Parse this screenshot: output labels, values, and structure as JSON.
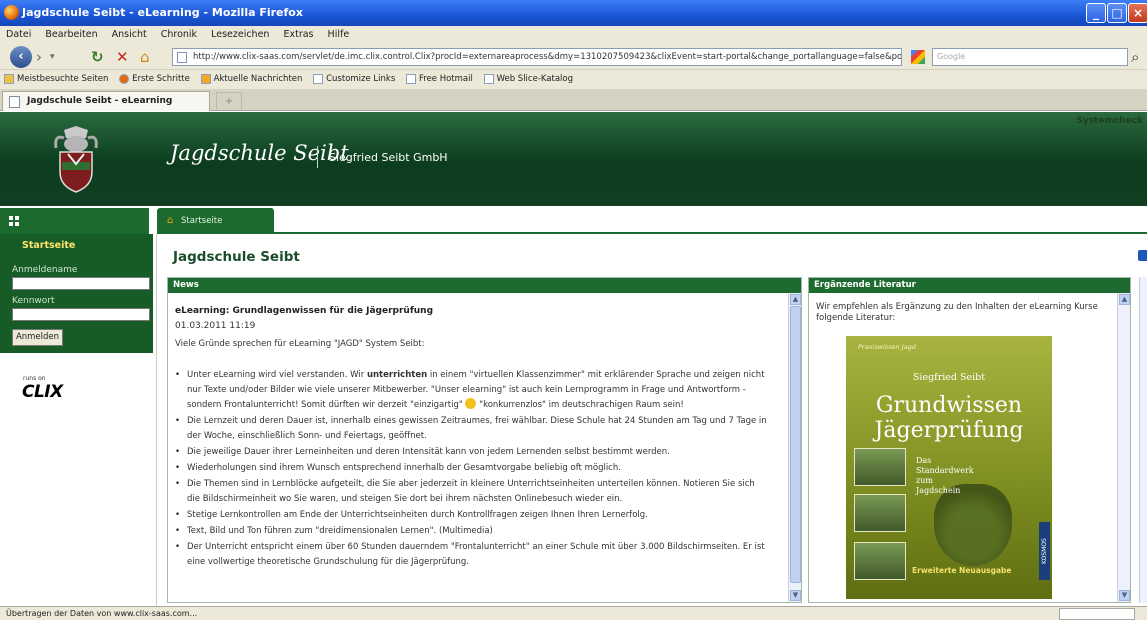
{
  "window": {
    "title": "Jagdschule Seibt - eLearning - Mozilla Firefox",
    "controls": {
      "minimize": "_",
      "maximize": "□",
      "close": "×"
    }
  },
  "menu": [
    "Datei",
    "Bearbeiten",
    "Ansicht",
    "Chronik",
    "Lesezeichen",
    "Extras",
    "Hilfe"
  ],
  "nav": {
    "url": "http://www.clix-saas.com/servlet/de.imc.clix.control.Clix?procId=externareaprocess&dmy=1310207509423&clixEvent=start-portal&change_portallanguage=false&porta",
    "search_placeholder": "Google"
  },
  "bookmarks": [
    "Meistbesuchte Seiten",
    "Erste Schritte",
    "Aktuelle Nachrichten",
    "Customize Links",
    "Free Hotmail",
    "Web Slice-Katalog"
  ],
  "tabs": {
    "active": "Jagdschule Seibt - eLearning",
    "new_tab": "+"
  },
  "header": {
    "title": "Jagdschule Seibt",
    "company": "Siegfried Seibt GmbH",
    "systemcheck": "Systemcheck"
  },
  "navtabs": {
    "start": "Startseite"
  },
  "sidebar": {
    "heading": "Startseite",
    "user_label": "Anmeldename",
    "password_label": "Kennwort",
    "login_button": "Anmelden",
    "runs_on": "runs on",
    "brand": "CLIX"
  },
  "main": {
    "title": "Jagdschule Seibt"
  },
  "news": {
    "heading": "News",
    "article_title": "eLearning: Grundlagenwissen für die Jägerprüfung",
    "date": "01.03.2011 11:19",
    "intro": "Viele Gründe sprechen für eLearning \"JAGD\" System Seibt:",
    "bullet1a": "Unter eLearning wird viel verstanden. Wir ",
    "bullet1b": "unterrichten",
    "bullet1c": " in einem \"virtuellen Klassenzimmer\" mit erklärender Sprache und zeigen nicht nur Texte und/oder Bilder wie viele unserer Mitbewerber. \"Unser elearning\" ist auch kein Lernprogramm in Frage und Antwortform - sondern Frontalunterricht! Somit dürften wir derzeit \"einzigartig\" ",
    "bullet1d": " \"konkurrenzlos\" im deutschrachigen Raum sein!",
    "bullets": [
      "Die Lernzeit und deren Dauer ist, innerhalb eines gewissen Zeitraumes, frei wählbar. Diese Schule hat 24 Stunden am Tag und 7 Tage in der Woche, einschließlich Sonn- und Feiertags, geöffnet.",
      "Die jeweilige Dauer ihrer Lerneinheiten und deren Intensität kann von jedem Lernenden selbst bestimmt werden.",
      "Wiederholungen sind ihrem Wunsch entsprechend innerhalb der Gesamtvorgabe beliebig oft möglich.",
      "Die Themen sind in Lernblöcke aufgeteilt, die Sie aber jederzeit in kleinere Unterrichtseinheiten unterteilen können. Notieren Sie sich die Bildschirmeinheit wo Sie waren, und steigen Sie dort bei ihrem nächsten Onlinebesuch wieder ein.",
      "Stetige Lernkontrollen am Ende der Unterrichtseinheiten durch Kontrollfragen zeigen Ihnen Ihren Lernerfolg.",
      "Text, Bild und Ton führen zum \"dreidimensionalen Lernen\". (Multimedia)",
      "Der Unterricht entspricht einem über 60 Stunden dauerndem \"Frontalunterricht\" an einer Schule mit über 3.000 Bildschirmseiten. Er ist eine vollwertige theoretische Grundschulung für die Jägerprüfung."
    ]
  },
  "literature": {
    "heading": "Ergänzende Literatur",
    "text": "Wir empfehlen als Ergänzung zu den Inhalten der eLearning Kurse folgende Literatur:",
    "book": {
      "series": "Praxiswissen Jagd",
      "author": "Siegfried Seibt",
      "title1": "Grundwissen",
      "title2": "Jägerprüfung",
      "subtitle": "Das Standardwerk zum Jagdschein",
      "edition": "Erweiterte Neuausgabe",
      "publisher": "KOSMOS"
    }
  },
  "status": {
    "text": "Übertragen der Daten von www.clix-saas.com..."
  }
}
